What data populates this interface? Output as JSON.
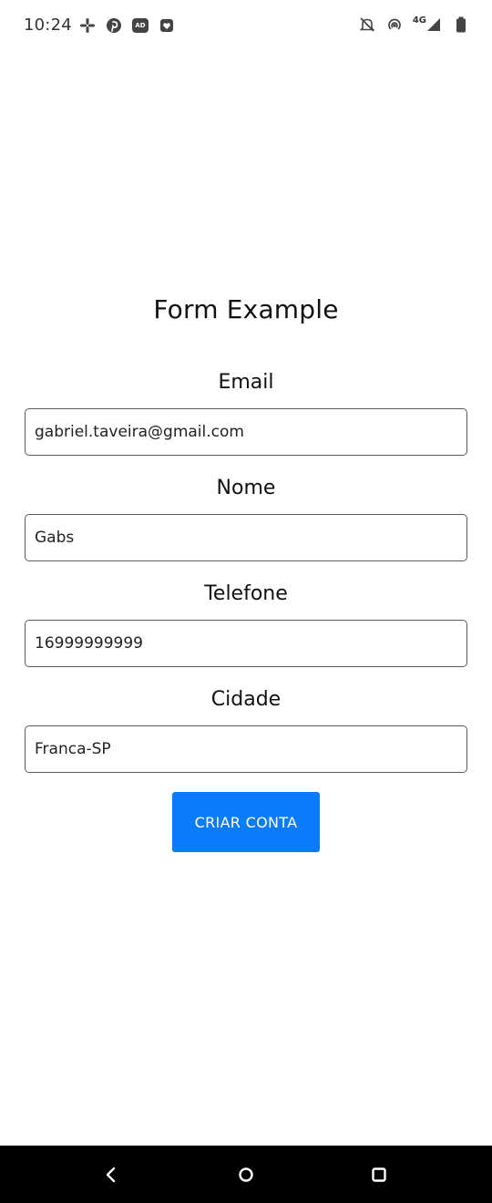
{
  "status_bar": {
    "time": "10:24",
    "left_icons": [
      "slack-icon",
      "pinterest-icon",
      "ad-icon",
      "heart-box-icon"
    ],
    "right_icons": [
      "bell-off-icon",
      "hotspot-icon",
      "signal-icon",
      "battery-icon"
    ],
    "network": "4G"
  },
  "form": {
    "title": "Form Example",
    "fields": [
      {
        "label": "Email",
        "value": "gabriel.taveira@gmail.com"
      },
      {
        "label": "Nome",
        "value": "Gabs"
      },
      {
        "label": "Telefone",
        "value": "16999999999"
      },
      {
        "label": "Cidade",
        "value": "Franca-SP"
      }
    ],
    "submit_label": "CRIAR CONTA"
  },
  "nav_bar": {
    "buttons": [
      "back-icon",
      "home-icon",
      "recents-icon"
    ]
  },
  "colors": {
    "accent": "#0a7cfa",
    "nav_background": "#000000",
    "input_border": "#5b5b5b"
  }
}
